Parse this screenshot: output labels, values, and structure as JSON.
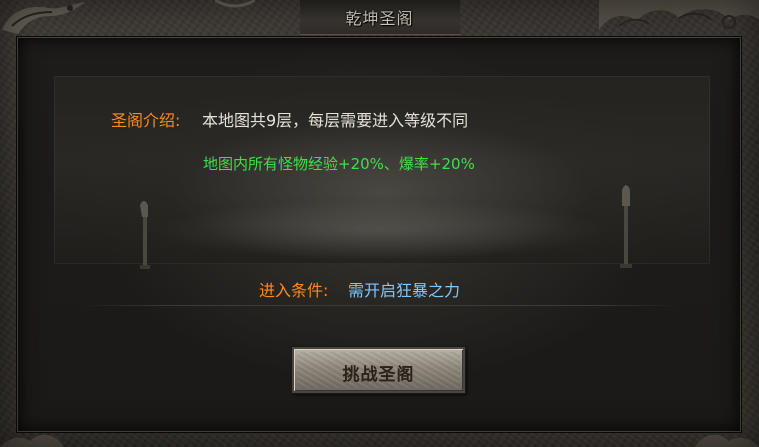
{
  "window": {
    "title": "乾坤圣阁"
  },
  "intro": {
    "label": "圣阁介绍:",
    "text": "本地图共9层，每层需要进入等级不同",
    "bonus": "地图内所有怪物经验+20%、爆率+20%"
  },
  "condition": {
    "label": "进入条件:",
    "text": "需开启狂暴之力"
  },
  "actions": {
    "challenge_label": "挑战圣阁"
  },
  "colors": {
    "label_orange": "#ff8a1c",
    "bonus_green": "#3ee04a",
    "condition_blue": "#7dc8ff",
    "body_text": "#e6e2d8"
  },
  "icons": {
    "top_left": "dragon-ornament-icon",
    "top_right": "cloud-ornament-icon",
    "pillars": "lantern-pillar-icon"
  }
}
